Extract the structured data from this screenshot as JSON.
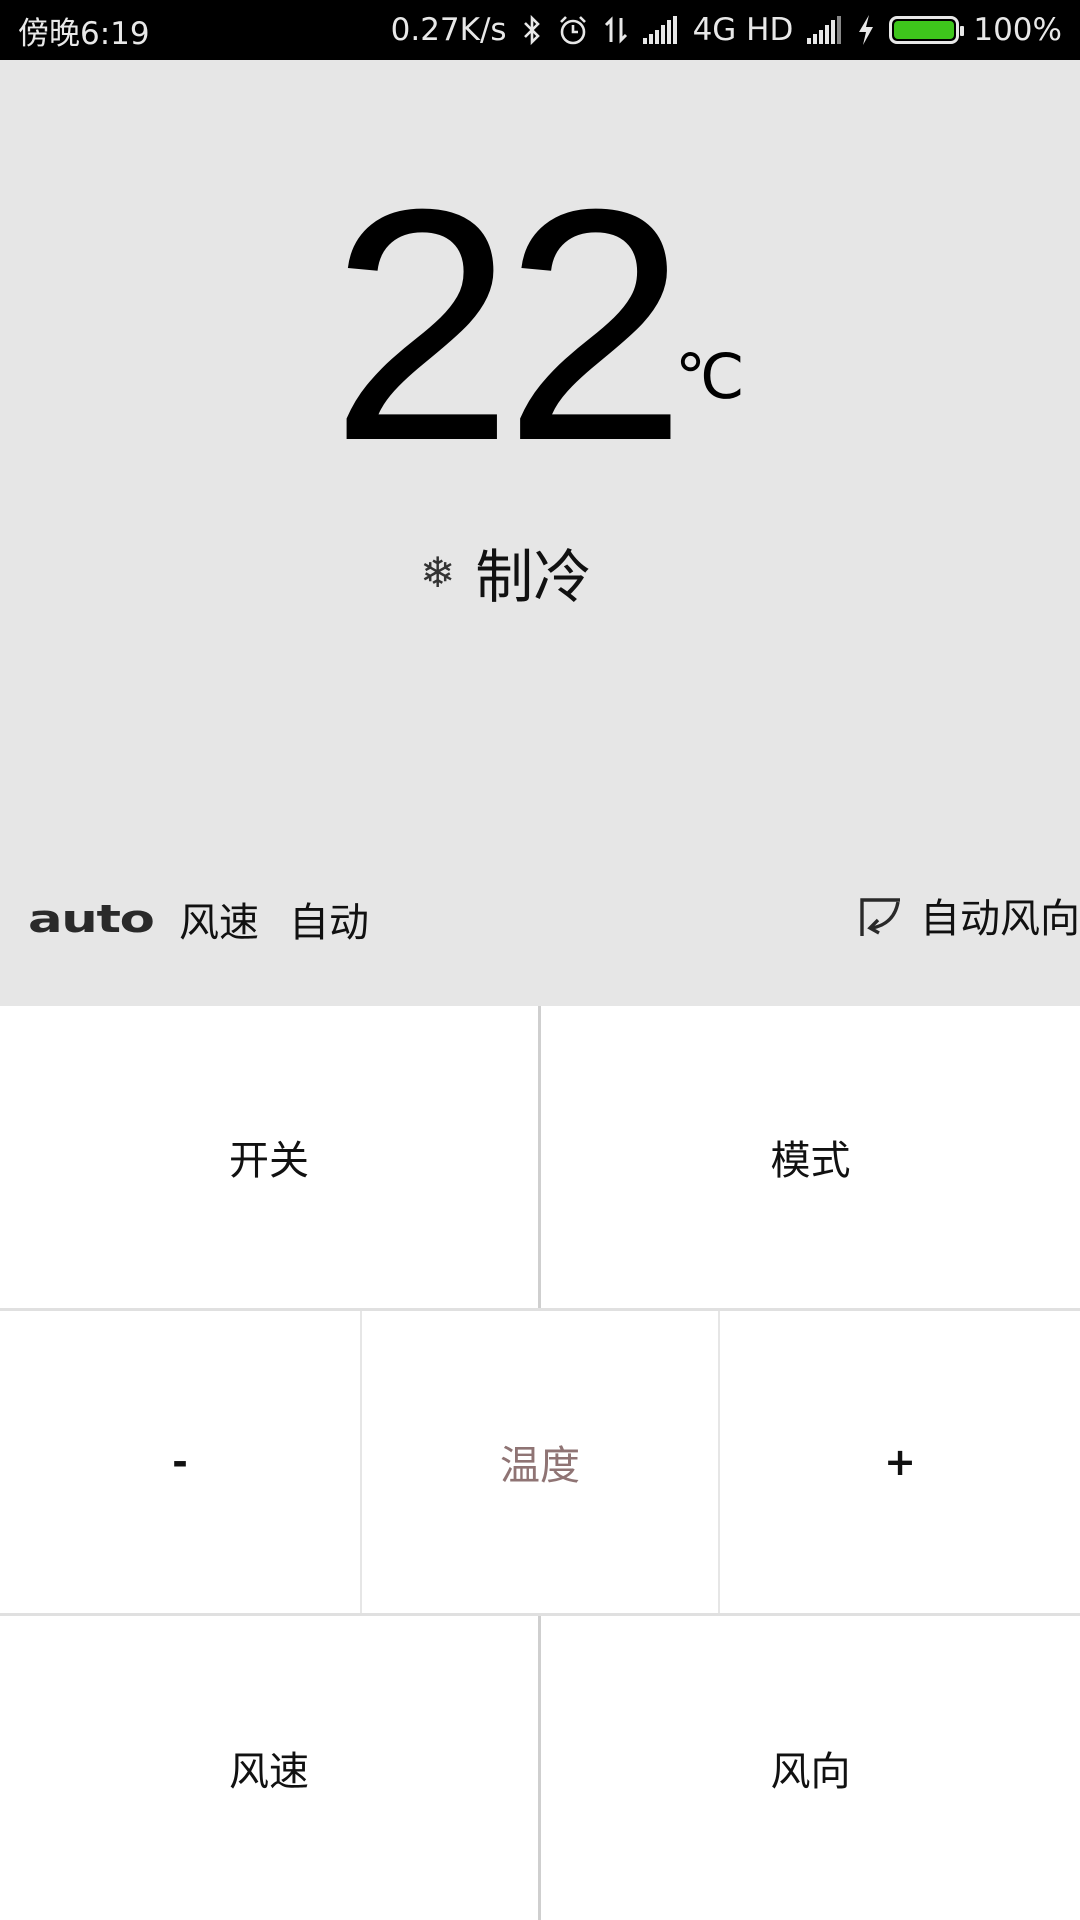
{
  "status_bar": {
    "time": "傍晚6:19",
    "net_speed": "0.27K/s",
    "network_type": "4G HD",
    "battery_percent": "100%",
    "battery_level": 1.0,
    "battery_color": "#3ec51c",
    "icons": [
      "bluetooth-icon",
      "alarm-icon",
      "data-transfer-icon",
      "signal-icon",
      "signal-icon",
      "charging-icon",
      "battery-icon"
    ]
  },
  "display": {
    "temperature": "22",
    "unit": "℃",
    "mode_icon": "snowflake-icon",
    "mode": "制冷",
    "fan_logo": "auto",
    "fan_label": "风速",
    "fan_value": "自动",
    "direction_icon": "swing-icon",
    "direction": "自动风向"
  },
  "controls": {
    "power": "开关",
    "mode": "模式",
    "temp_down": "-",
    "temp_label": "温度",
    "temp_up": "+",
    "fan_speed": "风速",
    "fan_direction": "风向"
  },
  "colors": {
    "display_bg": "#e6e6e6",
    "temp_label": "#8f7474"
  }
}
